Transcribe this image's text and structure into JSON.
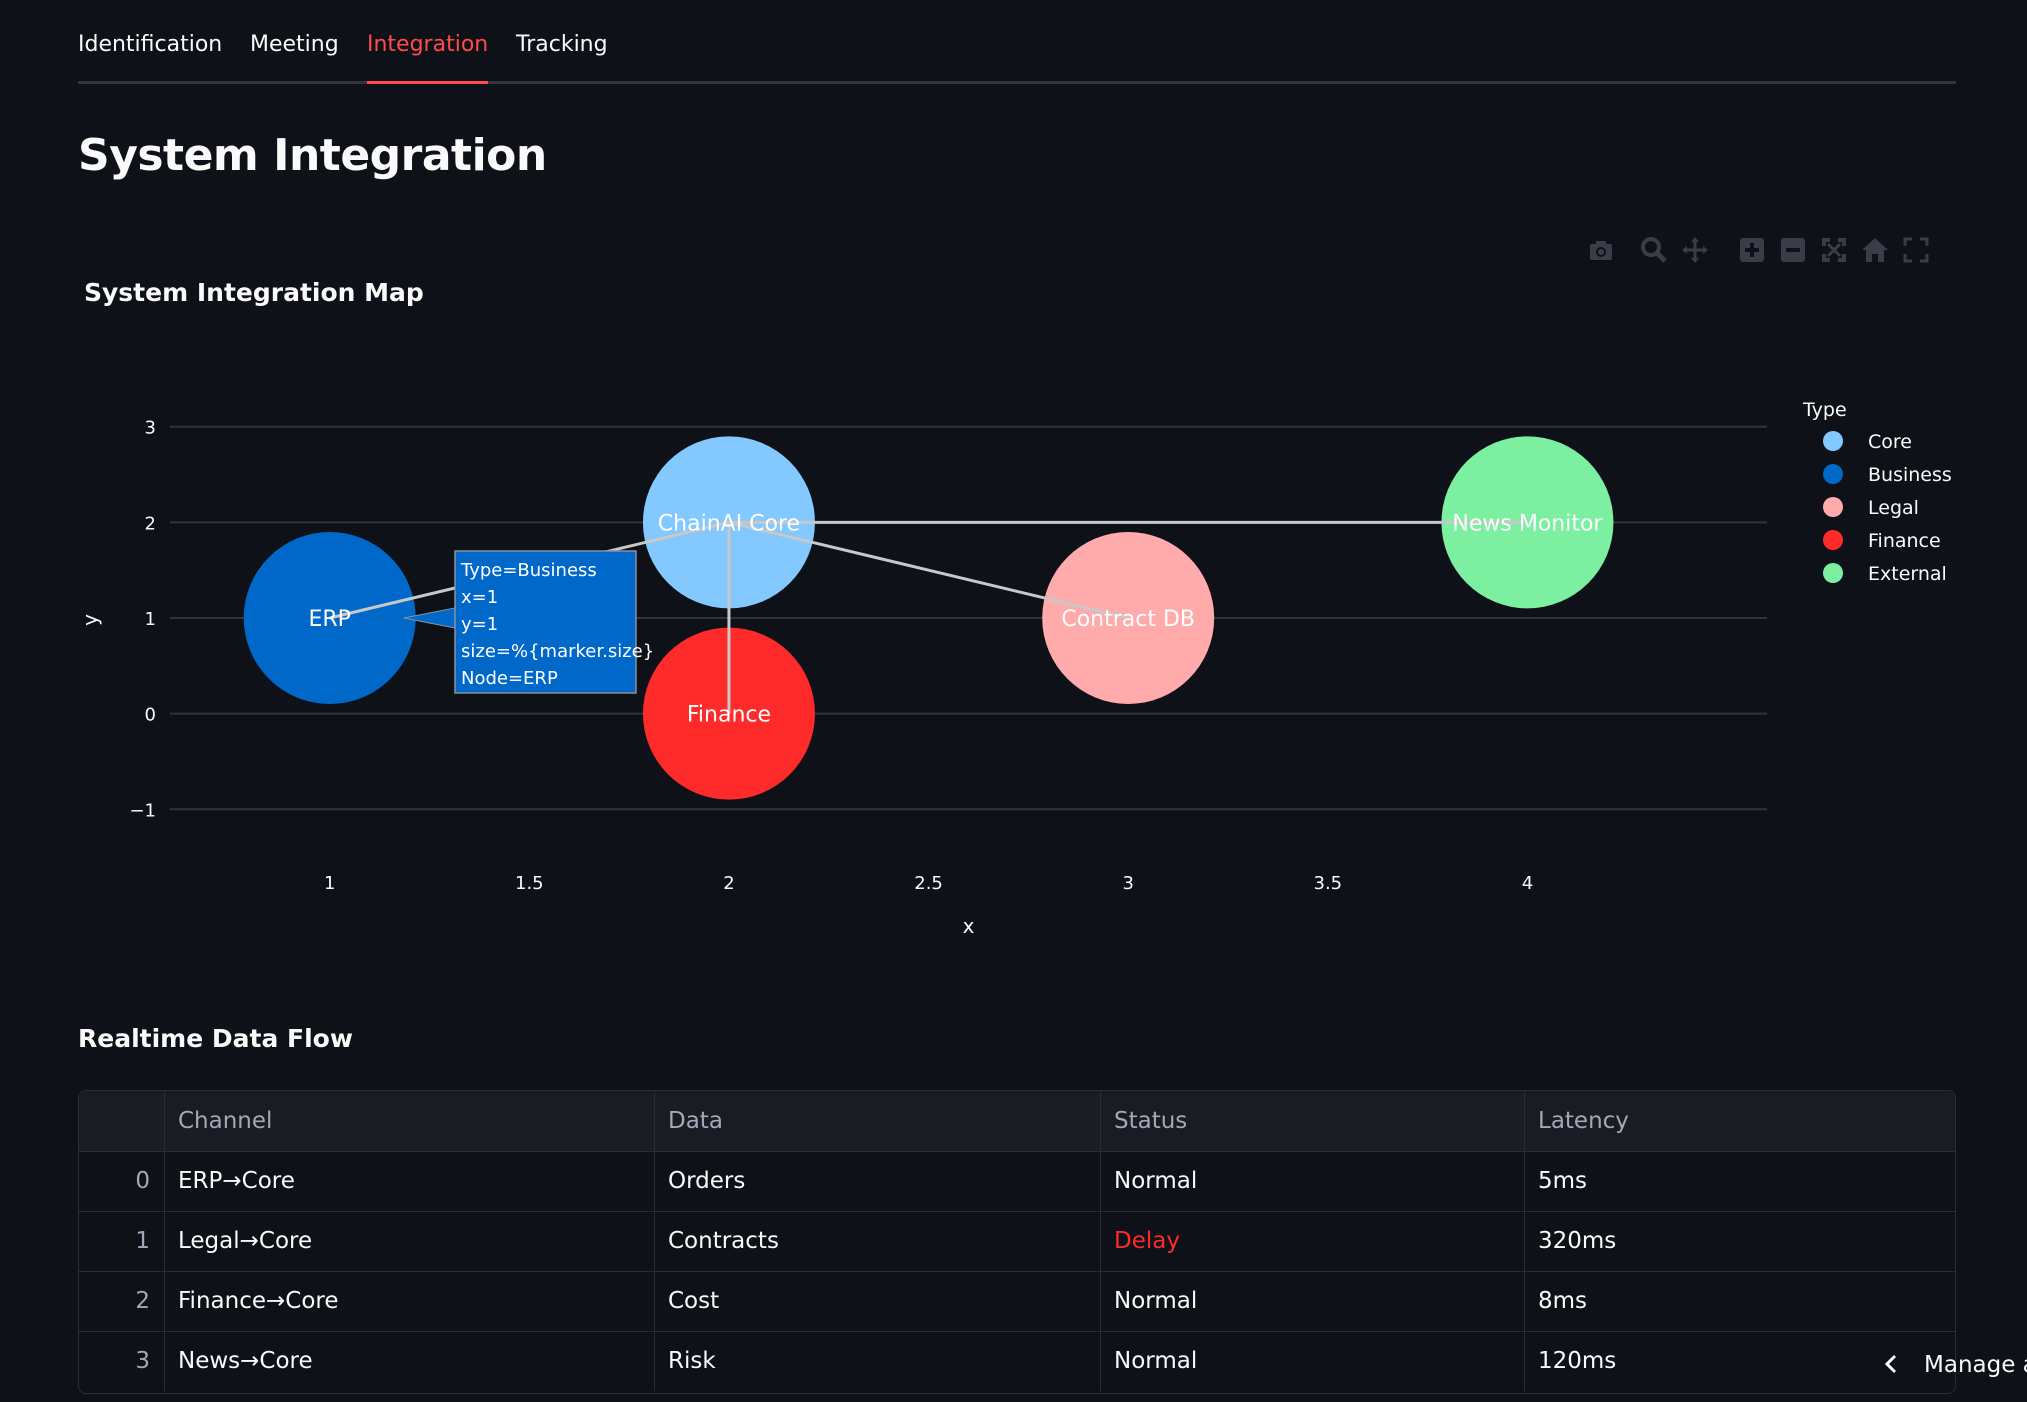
{
  "tabs": [
    {
      "label": "Identification",
      "active": false
    },
    {
      "label": "Meeting",
      "active": false
    },
    {
      "label": "Integration",
      "active": true
    },
    {
      "label": "Tracking",
      "active": false
    }
  ],
  "page_title": "System Integration",
  "modebar": [
    "camera-icon",
    "zoom-icon",
    "pan-icon",
    "zoom-in-icon",
    "zoom-out-icon",
    "autoscale-icon",
    "reset-axes-icon",
    "fullscreen-icon"
  ],
  "chart_data": {
    "type": "scatter",
    "title": "System Integration Map",
    "xlabel": "x",
    "ylabel": "y",
    "xlim": [
      0.6,
      4.6
    ],
    "ylim": [
      -1.3,
      3.3
    ],
    "xticks": [
      1,
      1.5,
      2,
      2.5,
      3,
      3.5,
      4
    ],
    "xtick_labels": [
      "1",
      "1.5",
      "2",
      "2.5",
      "3",
      "3.5",
      "4"
    ],
    "yticks": [
      -1,
      0,
      1,
      2,
      3
    ],
    "ytick_labels": [
      "−1",
      "0",
      "1",
      "2",
      "3"
    ],
    "grid": true,
    "legend": {
      "title": "Type",
      "placement": "right"
    },
    "series": [
      {
        "name": "Core",
        "color": "#83c9ff",
        "points": [
          {
            "x": 2,
            "y": 2,
            "label": "ChainAI Core"
          }
        ]
      },
      {
        "name": "Business",
        "color": "#0068c9",
        "points": [
          {
            "x": 1,
            "y": 1,
            "label": "ERP"
          }
        ]
      },
      {
        "name": "Legal",
        "color": "#ffabab",
        "points": [
          {
            "x": 3,
            "y": 1,
            "label": "Contract DB"
          }
        ]
      },
      {
        "name": "Finance",
        "color": "#ff2b2b",
        "points": [
          {
            "x": 2,
            "y": 0,
            "label": "Finance"
          }
        ]
      },
      {
        "name": "External",
        "color": "#7defa1",
        "points": [
          {
            "x": 4,
            "y": 2,
            "label": "News Monitor"
          }
        ]
      }
    ],
    "edges": [
      {
        "from": [
          1,
          1
        ],
        "to": [
          2,
          2
        ]
      },
      {
        "from": [
          3,
          1
        ],
        "to": [
          2,
          2
        ]
      },
      {
        "from": [
          2,
          0
        ],
        "to": [
          2,
          2
        ]
      },
      {
        "from": [
          4,
          2
        ],
        "to": [
          2,
          2
        ]
      }
    ],
    "tooltip": {
      "anchor": [
        1,
        1
      ],
      "lines": [
        "Type=Business",
        "x=1",
        "y=1",
        "size=%{marker.size}",
        "Node=ERP"
      ]
    }
  },
  "data_flow": {
    "title": "Realtime Data Flow",
    "columns": [
      "",
      "Channel",
      "Data",
      "Status",
      "Latency"
    ],
    "rows": [
      [
        "0",
        "ERP→Core",
        "Orders",
        "Normal",
        "5ms"
      ],
      [
        "1",
        "Legal→Core",
        "Contracts",
        "Delay",
        "320ms"
      ],
      [
        "2",
        "Finance→Core",
        "Cost",
        "Normal",
        "8ms"
      ],
      [
        "3",
        "News→Core",
        "Risk",
        "Normal",
        "120ms"
      ]
    ],
    "delay_color": "#ff2b2b"
  },
  "manage_app_label": "Manage app"
}
